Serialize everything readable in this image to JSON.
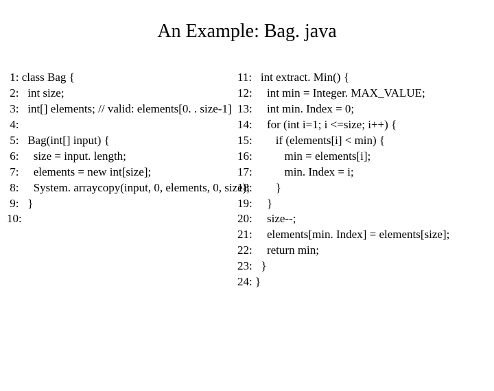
{
  "title": "An Example: Bag. java",
  "left": [
    " 1: class Bag {",
    " 2:   int size;",
    " 3:   int[] elements; // valid: elements[0. . size-1]",
    " 4:",
    " 5:   Bag(int[] input) {",
    " 6:     size = input. length;",
    " 7:     elements = new int[size];",
    " 8:     System. arraycopy(input, 0, elements, 0, size);",
    " 9:   }",
    "10:"
  ],
  "right": [
    "11:   int extract. Min() {",
    "12:     int min = Integer. MAX_VALUE;",
    "13:     int min. Index = 0;",
    "14:     for (int i=1; i <=size; i++) {",
    "15:        if (elements[i] < min) {",
    "16:           min = elements[i];",
    "17:           min. Index = i;",
    "18:        }",
    "19:     }",
    "20:     size--;",
    "21:     elements[min. Index] = elements[size];",
    "22:     return min;",
    "23:   }",
    "24: }"
  ]
}
